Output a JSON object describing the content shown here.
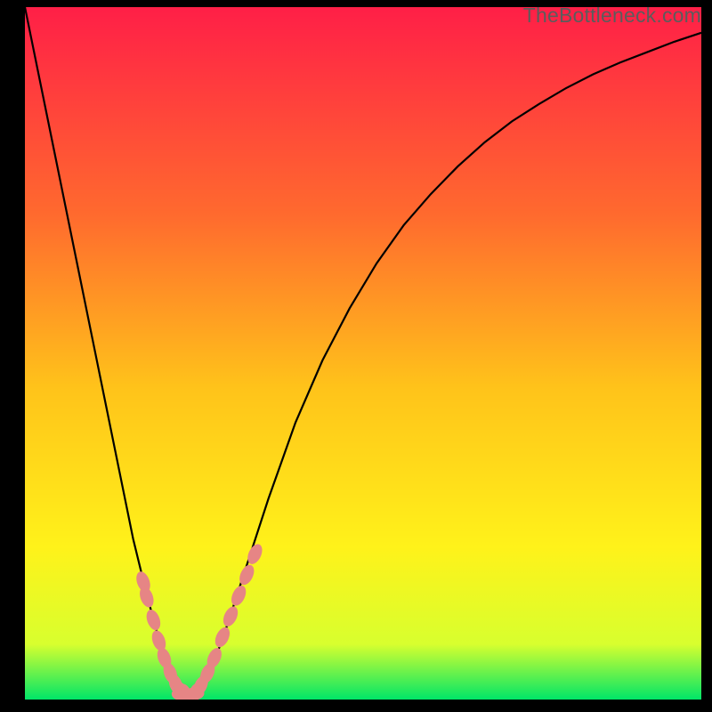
{
  "watermark": "TheBottleneck.com",
  "colors": {
    "gradient_top": "#ff1f47",
    "gradient_mid1": "#ff7a2a",
    "gradient_mid2": "#ffd21a",
    "gradient_mid3": "#fff51a",
    "gradient_bottom": "#00e568",
    "curve": "#000000",
    "beads": "#e68585",
    "bg": "#000000"
  },
  "chart_data": {
    "type": "line",
    "title": "",
    "xlabel": "",
    "ylabel": "",
    "xlim": [
      0,
      100
    ],
    "ylim": [
      0,
      100
    ],
    "x": [
      0,
      2,
      4,
      6,
      8,
      10,
      12,
      14,
      16,
      18,
      20,
      22,
      23,
      24,
      25,
      26,
      28,
      30,
      32,
      34,
      36,
      38,
      40,
      44,
      48,
      52,
      56,
      60,
      64,
      68,
      72,
      76,
      80,
      84,
      88,
      92,
      96,
      100
    ],
    "values": [
      100,
      90.4,
      80.8,
      71.2,
      61.6,
      52.0,
      42.4,
      32.8,
      23.2,
      15.2,
      8.0,
      3.2,
      1.6,
      0.8,
      0.8,
      1.6,
      5.5,
      11.0,
      17.0,
      23.0,
      29.0,
      34.5,
      40.0,
      49.0,
      56.5,
      63.0,
      68.5,
      73.0,
      77.0,
      80.5,
      83.5,
      86.0,
      88.3,
      90.3,
      92.0,
      93.5,
      95.0,
      96.3
    ],
    "annotations": {
      "left_beads_x": [
        17.5,
        18.0,
        19.0,
        19.8,
        20.6,
        21.5,
        22.3,
        23.0,
        23.7
      ],
      "left_beads_y": [
        17.0,
        14.8,
        11.5,
        8.5,
        6.0,
        3.8,
        2.2,
        1.2,
        0.8
      ],
      "right_beads_x": [
        25.2,
        26.0,
        27.0,
        28.0,
        29.2,
        30.4,
        31.6,
        32.8,
        34.0
      ],
      "right_beads_y": [
        1.0,
        2.0,
        3.8,
        6.0,
        9.0,
        12.0,
        15.0,
        18.0,
        21.0
      ],
      "bottom_beads_x": [
        23.0,
        23.7,
        24.5,
        25.2
      ],
      "bottom_beads_y": [
        0.8,
        0.6,
        0.6,
        0.9
      ]
    },
    "gradient_stops": [
      {
        "pct": 0,
        "color": "#ff1f47"
      },
      {
        "pct": 30,
        "color": "#ff6a2e"
      },
      {
        "pct": 55,
        "color": "#ffc31a"
      },
      {
        "pct": 78,
        "color": "#fff21a"
      },
      {
        "pct": 92,
        "color": "#d8ff2e"
      },
      {
        "pct": 100,
        "color": "#00e568"
      }
    ]
  }
}
